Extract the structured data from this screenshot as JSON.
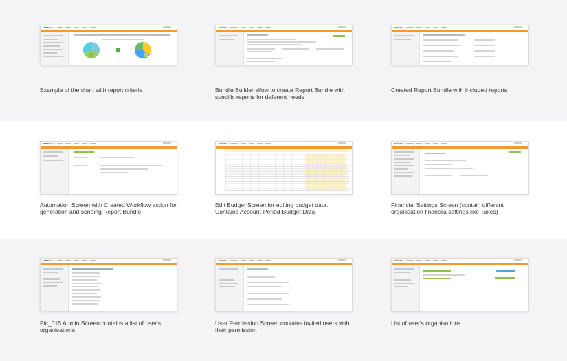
{
  "screens": [
    {
      "caption": "Example of the chart with report criteria",
      "thumb": "chart-report"
    },
    {
      "caption": "Bundle Builder allow to create Report Bundle with specific reports for deferent needs",
      "thumb": "bundle-builder"
    },
    {
      "caption": "Created Report Bundle with included reports",
      "thumb": "report-bundle"
    },
    {
      "caption": "Automation Screen with Created Workflow action for generation and sending Report Bundle",
      "thumb": "automation"
    },
    {
      "caption": "Edit Budget Screen for editing budget data. Contains Account-Period-Budget Data",
      "thumb": "edit-budget"
    },
    {
      "caption": "Financial Settings Screen (contain different organisation financila settings like Taxes)",
      "thumb": "financial-settings"
    },
    {
      "caption": "Pic_015 Admin Screen contains a list of user's organisations",
      "thumb": "admin"
    },
    {
      "caption": "User Permission Screen contains invited users with their permission",
      "thumb": "user-permission"
    },
    {
      "caption": "List of user's organisations",
      "thumb": "organisations"
    }
  ],
  "app": {
    "logo_main": "calxa",
    "logo_accent": "+ = x"
  },
  "colors": {
    "accent": "#f29a2e",
    "brand_green": "#8bc34a",
    "band": "#f4f4f6"
  }
}
